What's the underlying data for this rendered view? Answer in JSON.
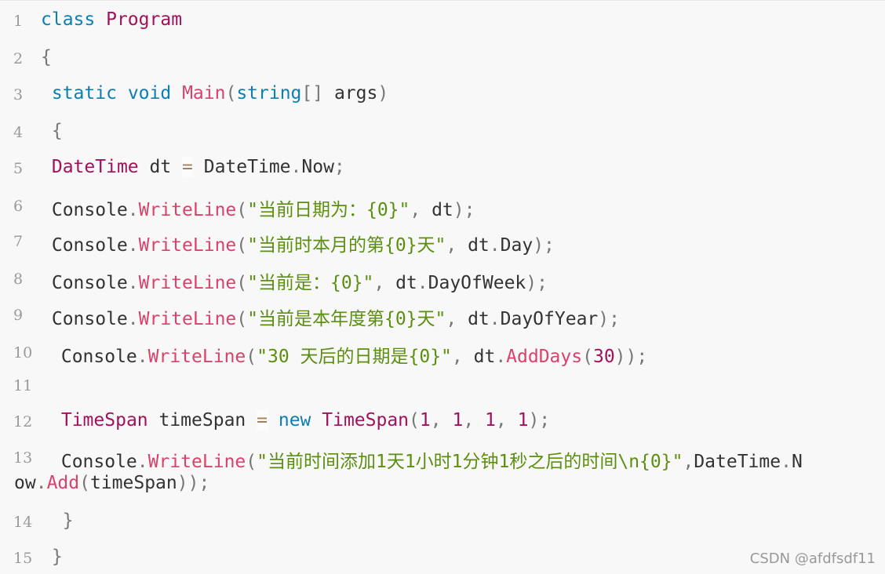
{
  "code": {
    "language": "C#",
    "lines": [
      {
        "number": "1",
        "tokens": [
          {
            "t": "class",
            "c": "kw"
          },
          {
            "t": " ",
            "c": "plain"
          },
          {
            "t": "Program",
            "c": "type"
          }
        ]
      },
      {
        "number": "2",
        "tokens": [
          {
            "t": "{",
            "c": "punc"
          }
        ]
      },
      {
        "number": "3",
        "tokens": [
          {
            "t": " ",
            "c": "plain"
          },
          {
            "t": "static",
            "c": "kw"
          },
          {
            "t": " ",
            "c": "plain"
          },
          {
            "t": "void",
            "c": "kw"
          },
          {
            "t": " ",
            "c": "plain"
          },
          {
            "t": "Main",
            "c": "method"
          },
          {
            "t": "(",
            "c": "punc"
          },
          {
            "t": "string",
            "c": "kw"
          },
          {
            "t": "[]",
            "c": "punc"
          },
          {
            "t": " args",
            "c": "plain"
          },
          {
            "t": ")",
            "c": "punc"
          }
        ]
      },
      {
        "number": "4",
        "tokens": [
          {
            "t": " ",
            "c": "plain"
          },
          {
            "t": "{",
            "c": "punc"
          }
        ]
      },
      {
        "number": "5",
        "tokens": [
          {
            "t": " ",
            "c": "plain"
          },
          {
            "t": "DateTime",
            "c": "type"
          },
          {
            "t": " dt ",
            "c": "plain"
          },
          {
            "t": "=",
            "c": "op"
          },
          {
            "t": " DateTime",
            "c": "plain"
          },
          {
            "t": ".",
            "c": "punc"
          },
          {
            "t": "Now",
            "c": "plain"
          },
          {
            "t": ";",
            "c": "punc"
          }
        ]
      },
      {
        "number": "6",
        "tokens": [
          {
            "t": " Console",
            "c": "plain"
          },
          {
            "t": ".",
            "c": "punc"
          },
          {
            "t": "WriteLine",
            "c": "method"
          },
          {
            "t": "(",
            "c": "punc"
          },
          {
            "t": "\"当前日期为：{0}\"",
            "c": "str"
          },
          {
            "t": ",",
            "c": "punc"
          },
          {
            "t": " dt",
            "c": "plain"
          },
          {
            "t": ");",
            "c": "punc"
          }
        ]
      },
      {
        "number": "7",
        "tokens": [
          {
            "t": " Console",
            "c": "plain"
          },
          {
            "t": ".",
            "c": "punc"
          },
          {
            "t": "WriteLine",
            "c": "method"
          },
          {
            "t": "(",
            "c": "punc"
          },
          {
            "t": "\"当前时本月的第{0}天\"",
            "c": "str"
          },
          {
            "t": ",",
            "c": "punc"
          },
          {
            "t": " dt",
            "c": "plain"
          },
          {
            "t": ".",
            "c": "punc"
          },
          {
            "t": "Day",
            "c": "plain"
          },
          {
            "t": ");",
            "c": "punc"
          }
        ]
      },
      {
        "number": "8",
        "tokens": [
          {
            "t": " Console",
            "c": "plain"
          },
          {
            "t": ".",
            "c": "punc"
          },
          {
            "t": "WriteLine",
            "c": "method"
          },
          {
            "t": "(",
            "c": "punc"
          },
          {
            "t": "\"当前是：{0}\"",
            "c": "str"
          },
          {
            "t": ",",
            "c": "punc"
          },
          {
            "t": " dt",
            "c": "plain"
          },
          {
            "t": ".",
            "c": "punc"
          },
          {
            "t": "DayOfWeek",
            "c": "plain"
          },
          {
            "t": ");",
            "c": "punc"
          }
        ]
      },
      {
        "number": "9",
        "tokens": [
          {
            "t": " Console",
            "c": "plain"
          },
          {
            "t": ".",
            "c": "punc"
          },
          {
            "t": "WriteLine",
            "c": "method"
          },
          {
            "t": "(",
            "c": "punc"
          },
          {
            "t": "\"当前是本年度第{0}天\"",
            "c": "str"
          },
          {
            "t": ",",
            "c": "punc"
          },
          {
            "t": " dt",
            "c": "plain"
          },
          {
            "t": ".",
            "c": "punc"
          },
          {
            "t": "DayOfYear",
            "c": "plain"
          },
          {
            "t": ");",
            "c": "punc"
          }
        ]
      },
      {
        "number": "10",
        "tokens": [
          {
            "t": " Console",
            "c": "plain"
          },
          {
            "t": ".",
            "c": "punc"
          },
          {
            "t": "WriteLine",
            "c": "method"
          },
          {
            "t": "(",
            "c": "punc"
          },
          {
            "t": "\"30 天后的日期是{0}\"",
            "c": "str"
          },
          {
            "t": ",",
            "c": "punc"
          },
          {
            "t": " dt",
            "c": "plain"
          },
          {
            "t": ".",
            "c": "punc"
          },
          {
            "t": "AddDays",
            "c": "method"
          },
          {
            "t": "(",
            "c": "punc"
          },
          {
            "t": "30",
            "c": "num"
          },
          {
            "t": "));",
            "c": "punc"
          }
        ]
      },
      {
        "number": "11",
        "tokens": []
      },
      {
        "number": "12",
        "tokens": [
          {
            "t": " ",
            "c": "plain"
          },
          {
            "t": "TimeSpan",
            "c": "type"
          },
          {
            "t": " timeSpan ",
            "c": "plain"
          },
          {
            "t": "=",
            "c": "op"
          },
          {
            "t": " ",
            "c": "plain"
          },
          {
            "t": "new",
            "c": "kw"
          },
          {
            "t": " ",
            "c": "plain"
          },
          {
            "t": "TimeSpan",
            "c": "type"
          },
          {
            "t": "(",
            "c": "punc"
          },
          {
            "t": "1",
            "c": "num"
          },
          {
            "t": ", ",
            "c": "punc"
          },
          {
            "t": "1",
            "c": "num"
          },
          {
            "t": ", ",
            "c": "punc"
          },
          {
            "t": "1",
            "c": "num"
          },
          {
            "t": ", ",
            "c": "punc"
          },
          {
            "t": "1",
            "c": "num"
          },
          {
            "t": ");",
            "c": "punc"
          }
        ]
      },
      {
        "number": "13",
        "tokens": [
          {
            "t": " Console",
            "c": "plain"
          },
          {
            "t": ".",
            "c": "punc"
          },
          {
            "t": "WriteLine",
            "c": "method"
          },
          {
            "t": "(",
            "c": "punc"
          },
          {
            "t": "\"当前时间添加1天1小时1分钟1秒之后的时间\\n{0}\"",
            "c": "str"
          },
          {
            "t": ",",
            "c": "punc"
          },
          {
            "t": "DateTime",
            "c": "plain"
          },
          {
            "t": ".",
            "c": "punc"
          },
          {
            "t": "N",
            "c": "plain"
          }
        ],
        "continuation": [
          {
            "t": "ow",
            "c": "plain"
          },
          {
            "t": ".",
            "c": "punc"
          },
          {
            "t": "Add",
            "c": "method"
          },
          {
            "t": "(",
            "c": "punc"
          },
          {
            "t": "timeSpan",
            "c": "plain"
          },
          {
            "t": "));",
            "c": "punc"
          }
        ]
      },
      {
        "number": "14",
        "tokens": [
          {
            "t": "  ",
            "c": "plain"
          },
          {
            "t": "}",
            "c": "punc"
          }
        ]
      },
      {
        "number": "15",
        "tokens": [
          {
            "t": " ",
            "c": "plain"
          },
          {
            "t": "}",
            "c": "punc"
          }
        ]
      }
    ]
  },
  "watermark": "CSDN @afdfsdf11"
}
